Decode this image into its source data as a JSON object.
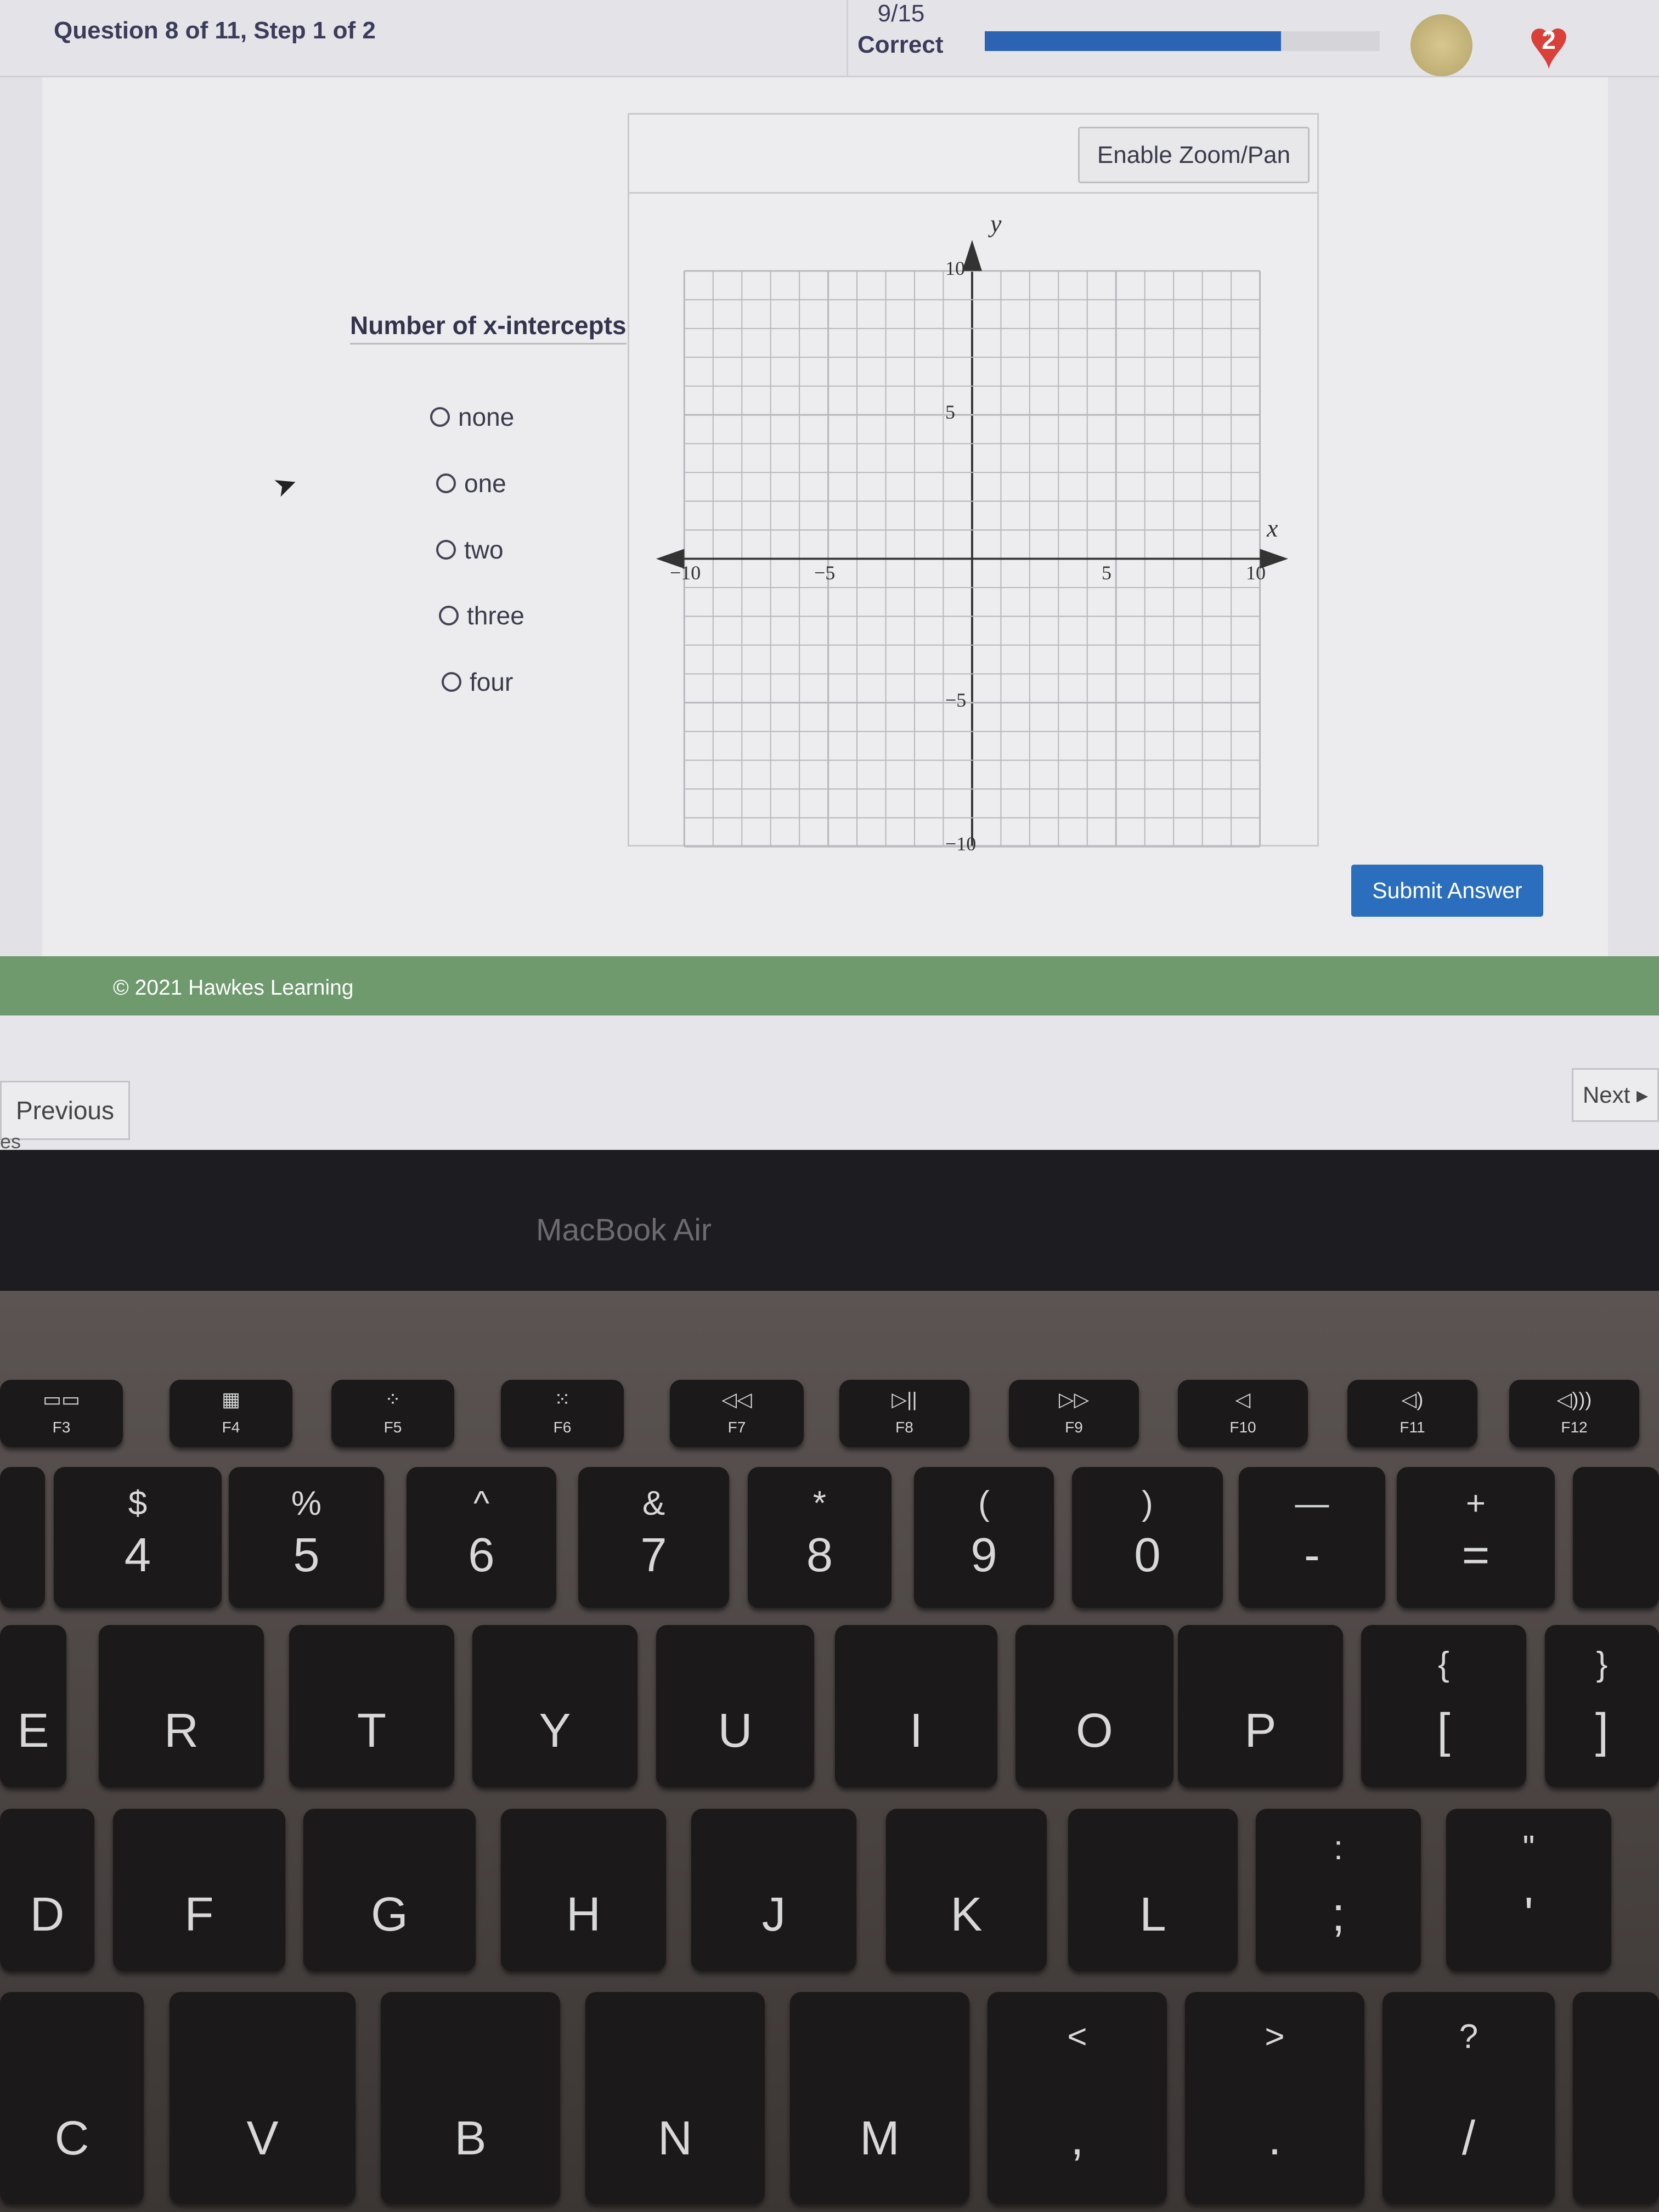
{
  "header": {
    "title": "Question 8 of 11, Step 1 of 2",
    "score": "9/15",
    "score_label": "Correct",
    "progress": 0.75,
    "lives": "2",
    "coin_icon": "coin-icon",
    "heart_icon": "heart-icon"
  },
  "graph": {
    "zoom_button": "Enable Zoom/Pan",
    "x_label": "x",
    "y_label": "y",
    "xlim": [
      -10,
      10
    ],
    "ylim": [
      -10,
      10
    ],
    "x_ticks": [
      "−10",
      "−5",
      "5",
      "10"
    ],
    "y_ticks": [
      "10",
      "5",
      "−5",
      "−10"
    ]
  },
  "question": {
    "label": "Number of x-intercepts",
    "options": [
      "none",
      "one",
      "two",
      "three",
      "four"
    ]
  },
  "submit": "Submit Answer",
  "footer": {
    "copyright": "© 2021 Hawkes Learning"
  },
  "nav": {
    "previous": "Previous",
    "next": "Next ▸",
    "partial": "es"
  },
  "bezel": {
    "brand": "MacBook Air"
  },
  "keyboard": {
    "fn": [
      {
        "s": "▭▭",
        "m": "F3"
      },
      {
        "s": "▦",
        "m": "F4"
      },
      {
        "s": "⁘",
        "m": "F5"
      },
      {
        "s": "⁙",
        "m": "F6"
      },
      {
        "s": "◁◁",
        "m": "F7"
      },
      {
        "s": "▷||",
        "m": "F8"
      },
      {
        "s": "▷▷",
        "m": "F9"
      },
      {
        "s": "◁",
        "m": "F10"
      },
      {
        "s": "◁)",
        "m": "F11"
      },
      {
        "s": "◁)))",
        "m": "F12"
      }
    ],
    "numbers": [
      {
        "s": "",
        "m": ""
      },
      {
        "s": "$",
        "m": "4"
      },
      {
        "s": "%",
        "m": "5"
      },
      {
        "s": "^",
        "m": "6"
      },
      {
        "s": "&",
        "m": "7"
      },
      {
        "s": "*",
        "m": "8"
      },
      {
        "s": "(",
        "m": "9"
      },
      {
        "s": ")",
        "m": "0"
      },
      {
        "s": "—",
        "m": "-"
      },
      {
        "s": "+",
        "m": "="
      },
      {
        "s": "",
        "m": ""
      }
    ],
    "top": [
      {
        "s": "",
        "m": "E"
      },
      {
        "s": "",
        "m": "R"
      },
      {
        "s": "",
        "m": "T"
      },
      {
        "s": "",
        "m": "Y"
      },
      {
        "s": "",
        "m": "U"
      },
      {
        "s": "",
        "m": "I"
      },
      {
        "s": "",
        "m": "O"
      },
      {
        "s": "",
        "m": "P"
      },
      {
        "s": "{",
        "m": "["
      },
      {
        "s": "}",
        "m": "]"
      }
    ],
    "home": [
      {
        "s": "",
        "m": "D"
      },
      {
        "s": "",
        "m": "F"
      },
      {
        "s": "",
        "m": "G"
      },
      {
        "s": "",
        "m": "H"
      },
      {
        "s": "",
        "m": "J"
      },
      {
        "s": "",
        "m": "K"
      },
      {
        "s": "",
        "m": "L"
      },
      {
        "s": ":",
        "m": ";"
      },
      {
        "s": "\"",
        "m": "'"
      }
    ],
    "bottom": [
      {
        "s": "",
        "m": "C"
      },
      {
        "s": "",
        "m": "V"
      },
      {
        "s": "",
        "m": "B"
      },
      {
        "s": "",
        "m": "N"
      },
      {
        "s": "",
        "m": "M"
      },
      {
        "s": "<",
        "m": ","
      },
      {
        "s": ">",
        "m": "."
      },
      {
        "s": "?",
        "m": "/"
      },
      {
        "s": "",
        "m": ""
      }
    ]
  }
}
